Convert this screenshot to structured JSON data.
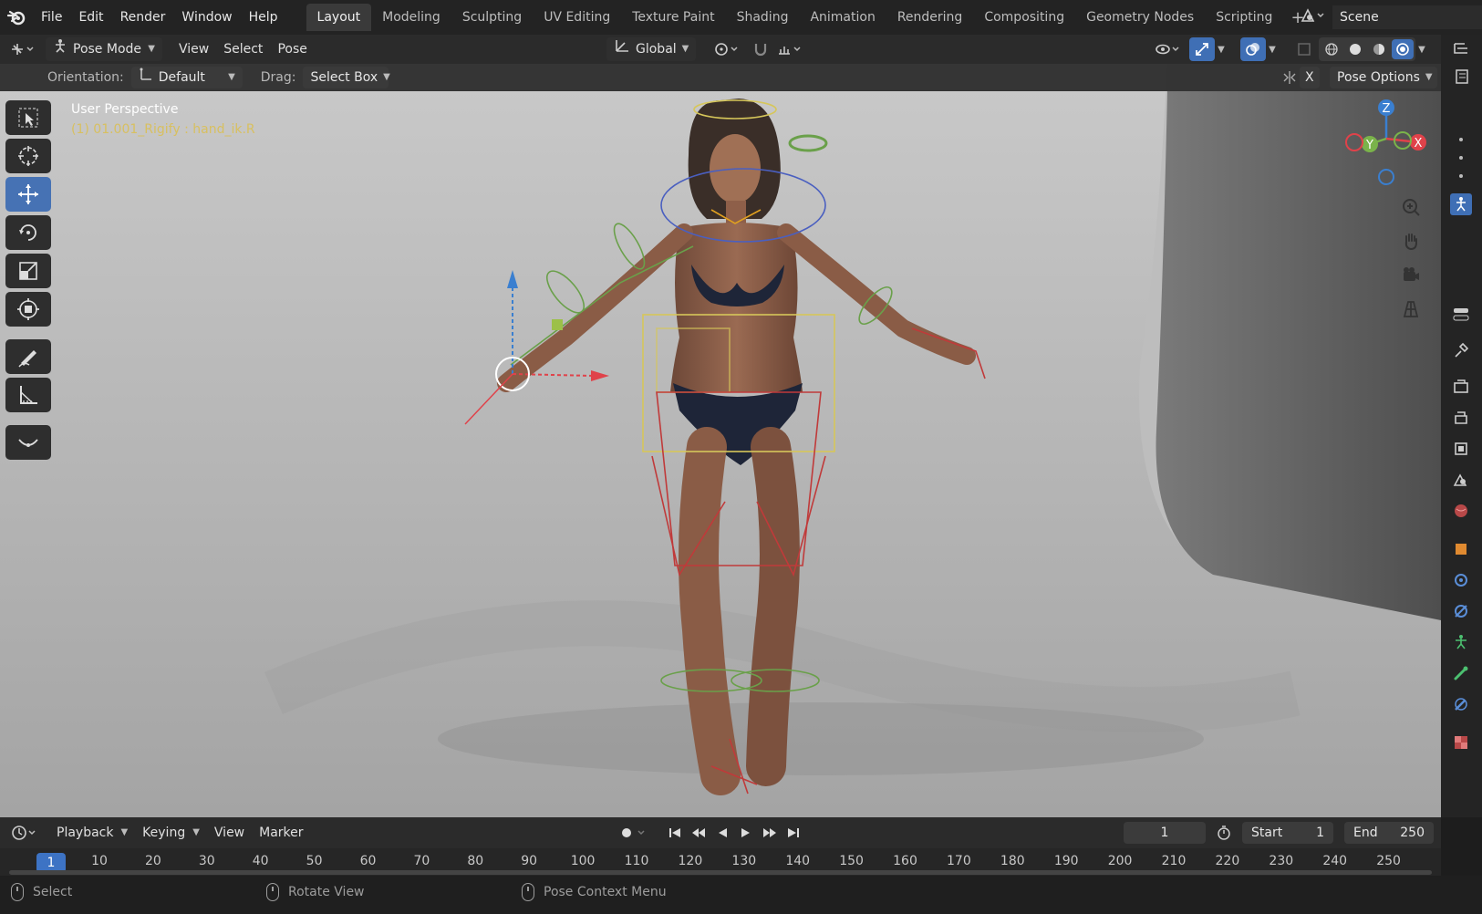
{
  "menu": {
    "items": [
      "File",
      "Edit",
      "Render",
      "Window",
      "Help"
    ]
  },
  "workspaces": {
    "tabs": [
      "Layout",
      "Modeling",
      "Sculpting",
      "UV Editing",
      "Texture Paint",
      "Shading",
      "Animation",
      "Rendering",
      "Compositing",
      "Geometry Nodes",
      "Scripting"
    ],
    "active": "Layout",
    "add_symbol": "+"
  },
  "scene": {
    "name": "Scene"
  },
  "header": {
    "mode": "Pose Mode",
    "view": "View",
    "select": "Select",
    "pose": "Pose",
    "transform_orientation": "Global"
  },
  "tool_settings": {
    "orientation_label": "Orientation:",
    "orientation_value": "Default",
    "drag_label": "Drag:",
    "drag_value": "Select Box",
    "x_mirror": "X",
    "pose_options": "Pose Options"
  },
  "viewport": {
    "perspective": "User Perspective",
    "active_info": "(1) 01.001_Rigify : hand_ik.R",
    "axes": {
      "x": "X",
      "y": "Y",
      "z": "Z"
    }
  },
  "tools": [
    "select-box",
    "cursor",
    "move",
    "rotate",
    "scale",
    "transform",
    "annotate",
    "measure",
    "relax-pose"
  ],
  "timeline": {
    "playback": "Playback",
    "keying": "Keying",
    "view": "View",
    "marker": "Marker",
    "current_frame": "1",
    "start_label": "Start",
    "start_value": "1",
    "end_label": "End",
    "end_value": "250",
    "ruler_current": "1",
    "ticks": [
      "10",
      "20",
      "30",
      "40",
      "50",
      "60",
      "70",
      "80",
      "90",
      "100",
      "110",
      "120",
      "130",
      "140",
      "150",
      "160",
      "170",
      "180",
      "190",
      "200",
      "210",
      "220",
      "230",
      "240",
      "250"
    ]
  },
  "statusbar": {
    "left": "Select",
    "middle": "Rotate View",
    "right": "Pose Context Menu"
  },
  "colors": {
    "accent": "#4672b4",
    "axis_x": "#e0424a",
    "axis_y": "#7ab34a",
    "axis_z": "#3a7fd0",
    "info_yellow": "#d8c060"
  }
}
